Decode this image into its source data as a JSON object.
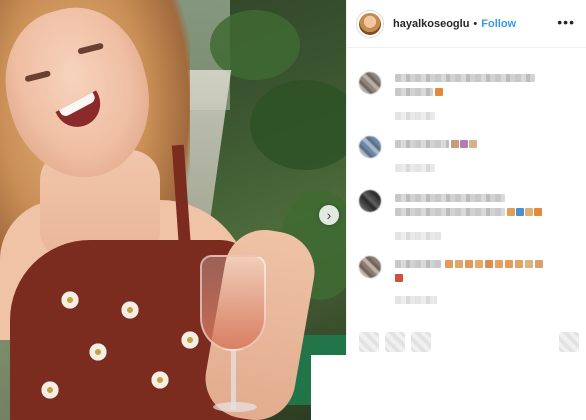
{
  "post": {
    "username": "hayalkoseoglu",
    "separator": "•",
    "follow_label": "Follow",
    "more_label": "•••",
    "next_arrow": "›"
  },
  "icons": {
    "next": "chevron-right-icon",
    "more": "more-options-icon",
    "like": "heart-icon",
    "comment": "comment-icon",
    "share": "share-icon",
    "save": "bookmark-icon"
  },
  "colors": {
    "follow": "#3897f0",
    "text": "#262626",
    "divider": "#efefef"
  }
}
